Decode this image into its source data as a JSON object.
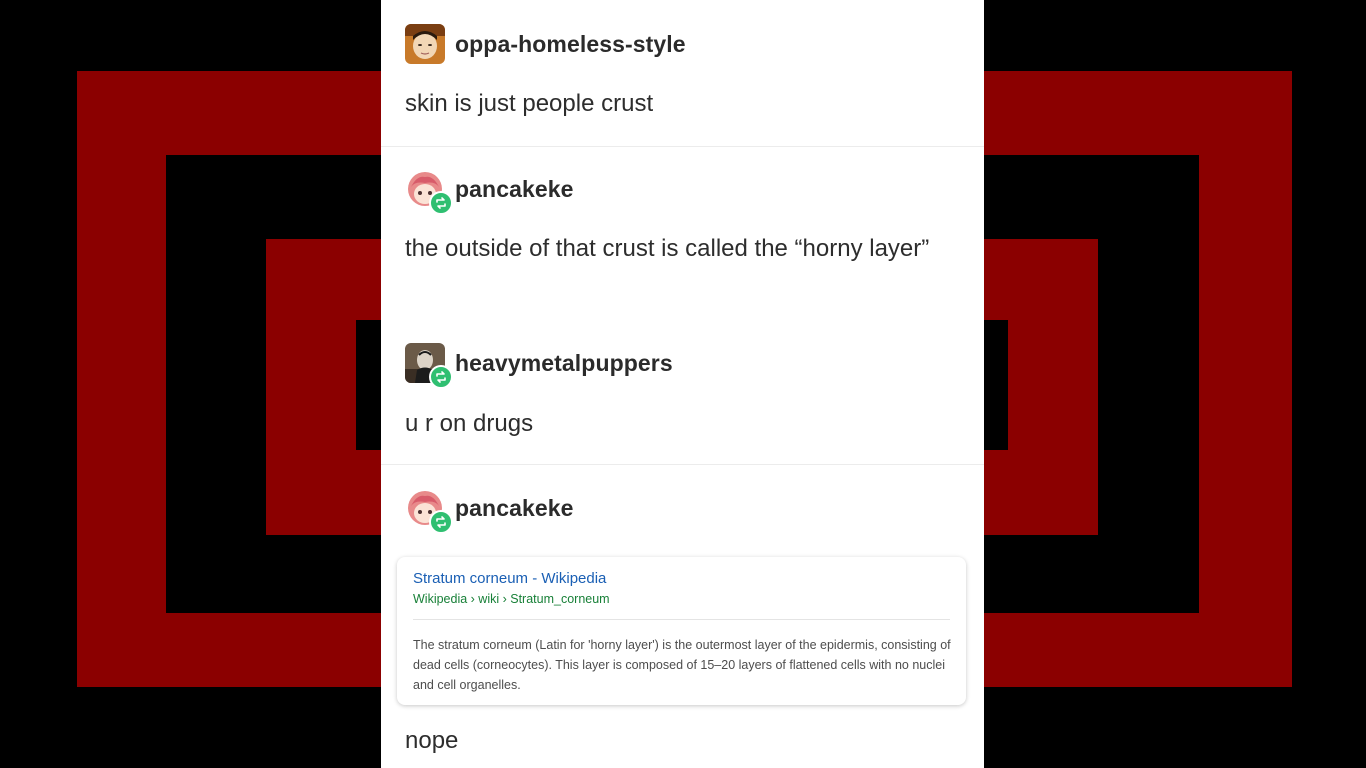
{
  "colors": {
    "background": "#000000",
    "pattern_red": "#8b0000",
    "reblog_green": "#2fbf71",
    "link_blue": "#1a5fb4",
    "url_green": "#188038"
  },
  "posts": [
    {
      "username": "oppa-homeless-style",
      "avatar_icon": "avatar-photo-icon",
      "reblogged": false,
      "text": "skin is just people crust"
    },
    {
      "username": "pancakeke",
      "avatar_icon": "avatar-anime-icon",
      "reblogged": true,
      "text": "the outside of that crust is called the “horny layer”"
    },
    {
      "username": "heavymetalpuppers",
      "avatar_icon": "avatar-photo-icon",
      "reblogged": true,
      "text": "u r on drugs"
    },
    {
      "username": "pancakeke",
      "avatar_icon": "avatar-anime-icon",
      "reblogged": true,
      "text": "nope"
    }
  ],
  "wiki_card": {
    "title": "Stratum corneum - Wikipedia",
    "url": "Wikipedia › wiki › Stratum_corneum",
    "snippet": "The stratum corneum (Latin for 'horny layer') is the outermost layer of the epidermis, consisting of dead cells (corneocytes). This layer is composed of 15–20 layers of flattened cells with no nuclei and cell organelles."
  }
}
